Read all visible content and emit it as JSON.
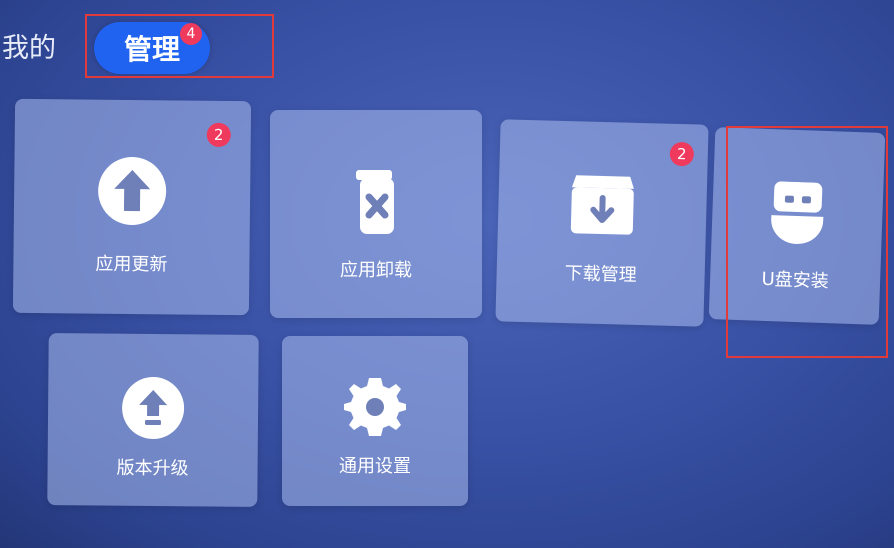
{
  "header": {
    "tab_mine": "我的",
    "tab_manage": "管理",
    "tab_manage_badge": "4"
  },
  "tiles": [
    {
      "label": "应用更新",
      "icon": "upload-circle-icon",
      "badge": "2"
    },
    {
      "label": "应用卸载",
      "icon": "trash-icon"
    },
    {
      "label": "下载管理",
      "icon": "download-box-icon",
      "badge": "2"
    },
    {
      "label": "U盘安装",
      "icon": "usb-drive-icon"
    },
    {
      "label": "版本升级",
      "icon": "upgrade-circle-icon"
    },
    {
      "label": "通用设置",
      "icon": "gear-icon"
    }
  ],
  "colors": {
    "accent": "#1f63f0",
    "badge": "#ef3a5d",
    "highlight": "#e03a3a"
  }
}
